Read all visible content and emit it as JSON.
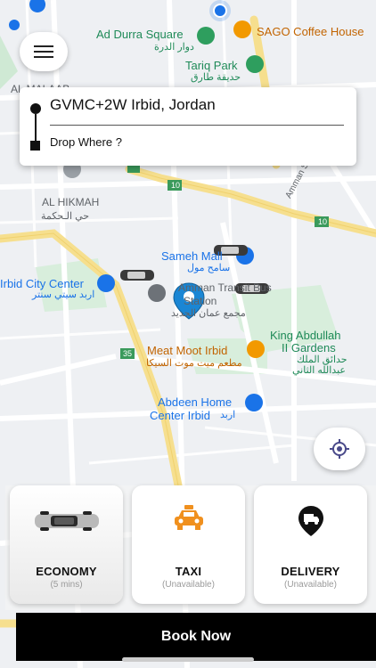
{
  "pickup": {
    "address": "GVMC+2W Irbid, Jordan"
  },
  "dropoff": {
    "placeholder": "Drop Where ?"
  },
  "map": {
    "labels": {
      "ad_durra_en": "Ad Durra Square",
      "ad_durra_ar": "دوار الدرة",
      "sago": "SAGO Coffee House",
      "tariq_en": "Tariq Park",
      "tariq_ar": "حديقة طارق",
      "al_malaab": "AL MALAAB",
      "al_hikmah_en": "AL HIKMAH",
      "al_hikmah_ar": "حي الـحكمة",
      "amman_st": "Amman St",
      "sameh_en": "Sameh Mall",
      "sameh_ar": "سامح مول",
      "transit_en_1": "Amman Transit Bus",
      "transit_en_2": "Station",
      "transit_ar": "مجمع عمان الجديد",
      "city_center_en": "Irbid City Center",
      "city_center_ar": "اربد سيتي سنتر",
      "meat_moot_en": "Meat Moot Irbid",
      "meat_moot_ar": "مطعم ميت موت السيكا",
      "king_abdullah_1": "King Abdullah",
      "king_abdullah_2": "II Gardens",
      "king_abdullah_ar_1": "حدائق الملك",
      "king_abdullah_ar_2": "عبدالله الثاني",
      "abdeen_1": "Abdeen Home",
      "abdeen_2": "Center Irbid",
      "abdeen_ar": "اربد",
      "route_10_a": "10",
      "route_10_b": "10",
      "route_35": "35"
    }
  },
  "services": [
    {
      "label": "ECONOMY",
      "sub": "(5 mins)",
      "icon": "car-icon"
    },
    {
      "label": "TAXI",
      "sub": "(Unavailable)",
      "icon": "taxi-icon"
    },
    {
      "label": "DELIVERY",
      "sub": "(Unavailable)",
      "icon": "delivery-pin-icon"
    }
  ],
  "actions": {
    "book_label": "Book Now"
  },
  "colors": {
    "accent_taxi": "#f0901e",
    "button": "#000000",
    "map_bg": "#eef0f3",
    "road_major": "#f6df8e"
  }
}
